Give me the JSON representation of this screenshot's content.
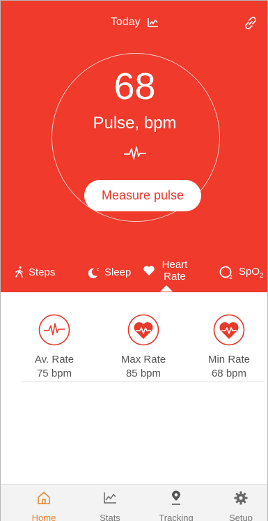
{
  "header": {
    "title": "Today"
  },
  "pulse": {
    "value": "68",
    "label": "Pulse, bpm",
    "measure_label": "Measure pulse"
  },
  "tabs": [
    {
      "label": "Steps",
      "icon": "walk-icon"
    },
    {
      "label": "Sleep",
      "icon": "moon-icon"
    },
    {
      "label": "Heart Rate",
      "icon": "heart-icon",
      "active": true
    },
    {
      "label": "SpO",
      "sub": "2",
      "icon": "o2-icon"
    }
  ],
  "rates": [
    {
      "name": "Av. Rate",
      "value": "75 bpm",
      "icon": "wave-circle-icon"
    },
    {
      "name": "Max Rate",
      "value": "85 bpm",
      "icon": "heart-circle-icon"
    },
    {
      "name": "Min Rate",
      "value": "68 bpm",
      "icon": "heart-circle-icon"
    }
  ],
  "bottom_nav": [
    {
      "label": "Home",
      "icon": "home-icon",
      "active": true
    },
    {
      "label": "Stats",
      "icon": "chart-icon"
    },
    {
      "label": "Tracking",
      "icon": "location-pin-icon"
    },
    {
      "label": "Setup",
      "icon": "gear-icon"
    }
  ],
  "colors": {
    "accent": "#EF3A2C",
    "active_nav": "#E8842A",
    "text_muted": "#555555"
  }
}
